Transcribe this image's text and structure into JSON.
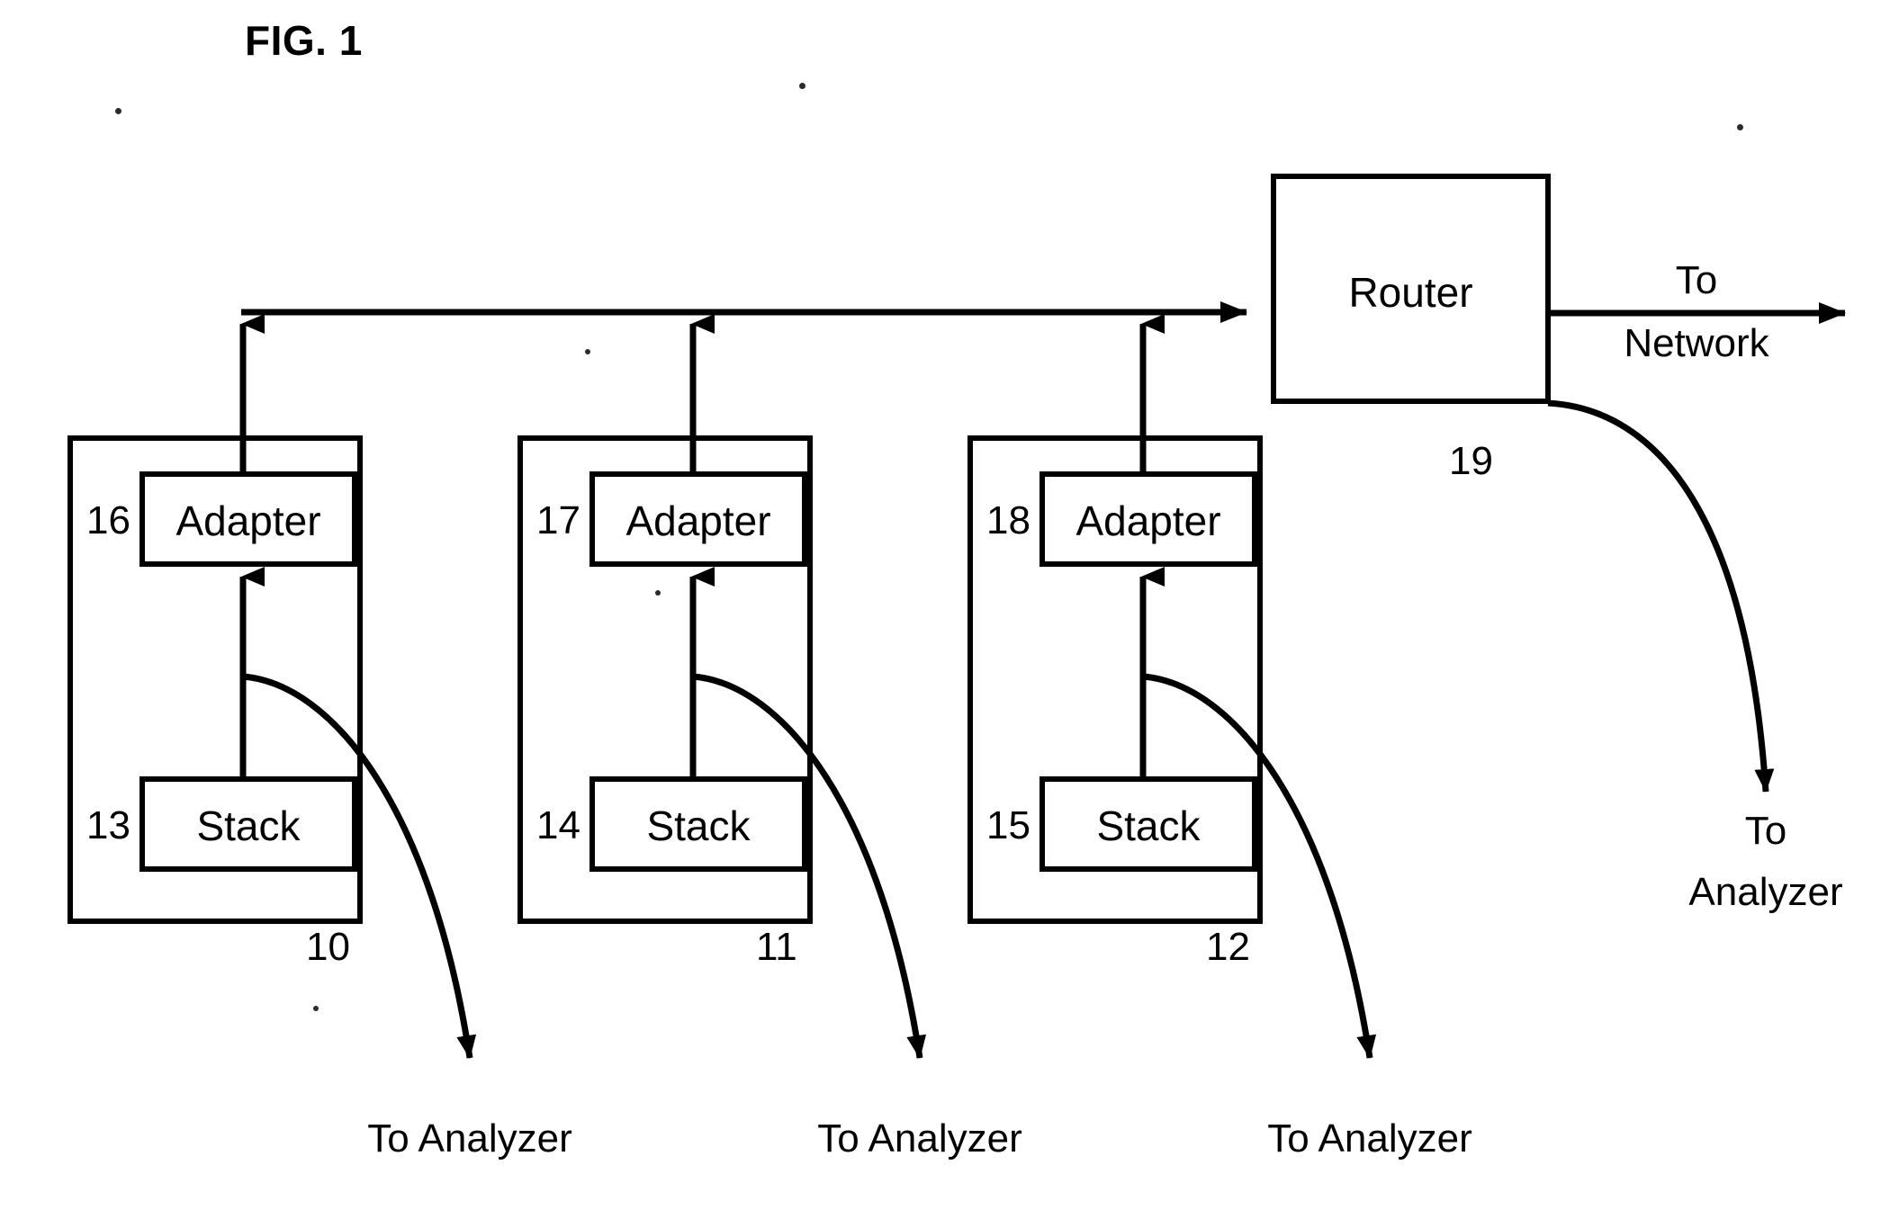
{
  "figure": {
    "title": "FIG. 1"
  },
  "modules": [
    {
      "outer_ref": "10",
      "adapter_ref": "16",
      "adapter_label": "Adapter",
      "stack_ref": "13",
      "stack_label": "Stack",
      "tap_label": "To Analyzer"
    },
    {
      "outer_ref": "11",
      "adapter_ref": "17",
      "adapter_label": "Adapter",
      "stack_ref": "14",
      "stack_label": "Stack",
      "tap_label": "To Analyzer"
    },
    {
      "outer_ref": "12",
      "adapter_ref": "18",
      "adapter_label": "Adapter",
      "stack_ref": "15",
      "stack_label": "Stack",
      "tap_label": "To Analyzer"
    }
  ],
  "router": {
    "label": "Router",
    "ref": "19"
  },
  "network_flow": {
    "line1": "To",
    "line2": "Network"
  },
  "router_tap": {
    "line1": "To",
    "line2": "Analyzer"
  },
  "colors": {
    "ink": "#000000",
    "paper": "#ffffff"
  }
}
